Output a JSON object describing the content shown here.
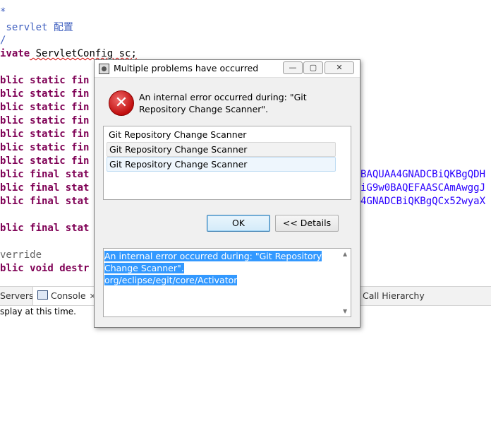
{
  "editor": {
    "lines": [
      {
        "pre": "*",
        "kw": "",
        "rest": "",
        "tail": ""
      },
      {
        "pre": " servlet 配置",
        "kw": "",
        "rest": "",
        "tail": ""
      },
      {
        "pre": "/",
        "kw": "",
        "rest": "",
        "tail": ""
      },
      {
        "pre": "",
        "kw": "ivate",
        "rest": " ServletConfig sc;",
        "tail": ""
      },
      {
        "pre": "",
        "kw": "blic static fin",
        "rest": "",
        "tail": ""
      },
      {
        "pre": "",
        "kw": "blic static fin",
        "rest": "",
        "tail": ""
      },
      {
        "pre": "",
        "kw": "blic static fin",
        "rest": "",
        "tail": ""
      },
      {
        "pre": "",
        "kw": "blic static fin",
        "rest": "",
        "tail": ""
      },
      {
        "pre": "",
        "kw": "blic static fin",
        "rest": "",
        "tail": ""
      },
      {
        "pre": "",
        "kw": "blic static fin",
        "rest": "",
        "tail": ""
      },
      {
        "pre": "",
        "kw": "blic static fin",
        "rest": "",
        "tail": ""
      },
      {
        "pre": "",
        "kw": "blic final stat",
        "rest": "",
        "tail": "BAQUAA4GNADCBiQKBgQDH"
      },
      {
        "pre": "",
        "kw": "blic final stat",
        "rest": "",
        "tail": "iG9w0BAQEFAASCAmAwggJ"
      },
      {
        "pre": "",
        "kw": "blic final stat",
        "rest": "",
        "tail": "4GNADCBiQKBgQCx52wyaX"
      },
      {
        "pre": "",
        "kw": "",
        "rest": "",
        "tail": ""
      },
      {
        "pre": "",
        "kw": "blic final stat",
        "rest": "",
        "tail": ""
      },
      {
        "pre": "",
        "kw": "",
        "rest": "",
        "tail": ""
      },
      {
        "pre": "verride",
        "kw": "",
        "rest": "",
        "tail": ""
      },
      {
        "pre": "",
        "kw": "blic void destr",
        "rest": "",
        "tail": ""
      }
    ]
  },
  "panel": {
    "tabs": {
      "servers": "Servers",
      "console": "Console",
      "console_close": "✕",
      "call_hierarchy": "Call Hierarchy"
    },
    "body_text": "splay at this time."
  },
  "dialog": {
    "title": "Multiple problems have occurred",
    "error_message": "An internal error occurred during: \"Git Repository Change Scanner\".",
    "problems": [
      "Git Repository Change Scanner",
      "Git Repository Change Scanner",
      "Git Repository Change Scanner"
    ],
    "ok_label": "OK",
    "details_label": "<< Details",
    "details_lines": [
      "An internal error occurred during: \"Git Repository",
      "Change Scanner\".",
      "  org/eclipse/egit/core/Activator"
    ],
    "win_buttons": {
      "minimize": "—",
      "maximize": "▢",
      "close": "✕"
    }
  },
  "colors": {
    "keyword": "#7f0055",
    "string": "#2a00ff",
    "selection": "#3399ff",
    "error": "#c00e0e"
  }
}
